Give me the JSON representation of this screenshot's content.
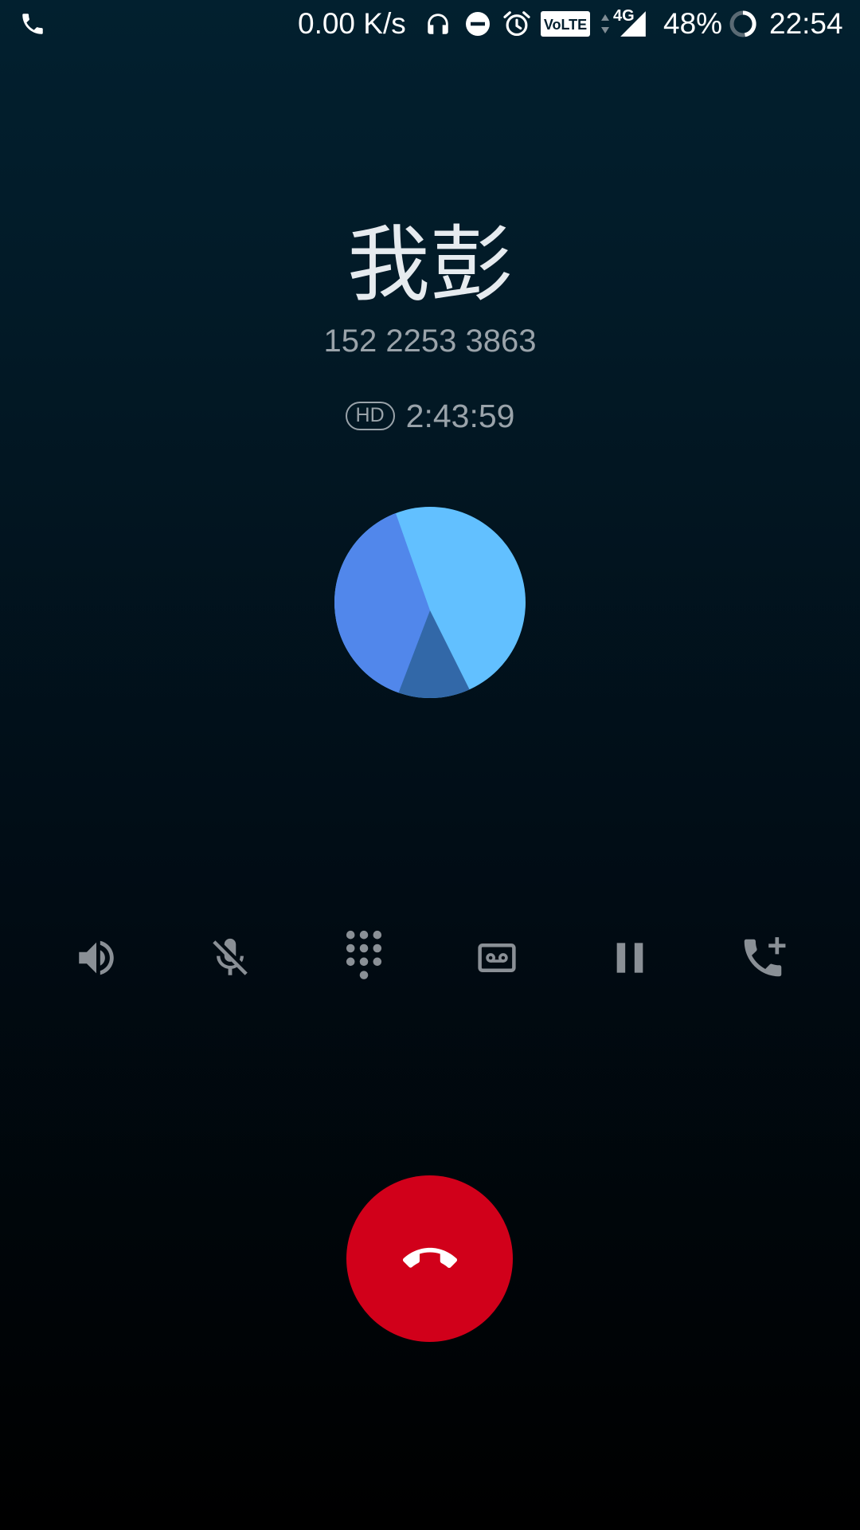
{
  "status_bar": {
    "call_icon": "phone-icon",
    "net_speed": "0.00 K/s",
    "headset_icon": "headphones-icon",
    "dnd_icon": "do-not-disturb-icon",
    "alarm_icon": "alarm-icon",
    "volte": "VoLTE",
    "network": "4G",
    "signal_icon": "signal-icon",
    "battery": "48%",
    "battery_icon": "battery-ring-icon",
    "time": "22:54"
  },
  "call": {
    "contact_name": "我彭",
    "phone_number": "152 2253 3863",
    "hd_label": "HD",
    "duration": "2:43:59"
  },
  "avatar": {
    "icon": "contact-avatar-icon",
    "colors": [
      "#62c0ff",
      "#5187eb",
      "#3268a8"
    ]
  },
  "controls": [
    {
      "name": "speaker",
      "icon": "speaker-icon"
    },
    {
      "name": "mute",
      "icon": "mic-off-icon"
    },
    {
      "name": "dialpad",
      "icon": "dialpad-icon"
    },
    {
      "name": "record",
      "icon": "record-cassette-icon"
    },
    {
      "name": "hold",
      "icon": "pause-icon"
    },
    {
      "name": "add-call",
      "icon": "add-call-icon"
    }
  ],
  "end_call": {
    "icon": "call-end-icon",
    "color": "#d1001a"
  },
  "colors": {
    "background_top": "#02202f",
    "background_bottom": "#000000",
    "secondary_text": "#9aa3aa",
    "control_icon": "#8a9096"
  }
}
